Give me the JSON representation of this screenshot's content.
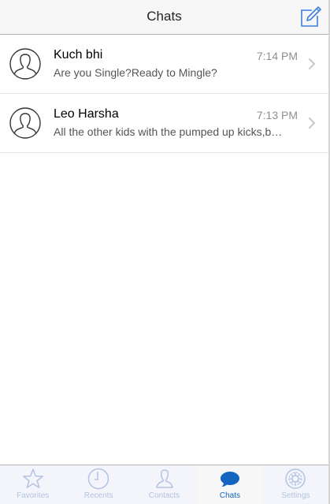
{
  "nav": {
    "title": "Chats",
    "compose_icon": "compose-icon"
  },
  "chats": [
    {
      "name": "Kuch bhi",
      "time": "7:14 PM",
      "preview": "Are you Single?Ready to Mingle?"
    },
    {
      "name": "Leo Harsha",
      "time": "7:13 PM",
      "preview": "All the other kids with the pumped up kicks,better run,better run"
    }
  ],
  "tabs": [
    {
      "label": "Favorites",
      "icon": "star-icon",
      "active": false
    },
    {
      "label": "Recents",
      "icon": "clock-icon",
      "active": false
    },
    {
      "label": "Contacts",
      "icon": "person-icon",
      "active": false
    },
    {
      "label": "Chats",
      "icon": "chat-bubble-icon",
      "active": true
    },
    {
      "label": "Settings",
      "icon": "gear-icon",
      "active": false
    }
  ],
  "colors": {
    "accent": "#1565c0",
    "inactive_tab": "#b3c3e3",
    "time_text": "#8e8e93"
  }
}
